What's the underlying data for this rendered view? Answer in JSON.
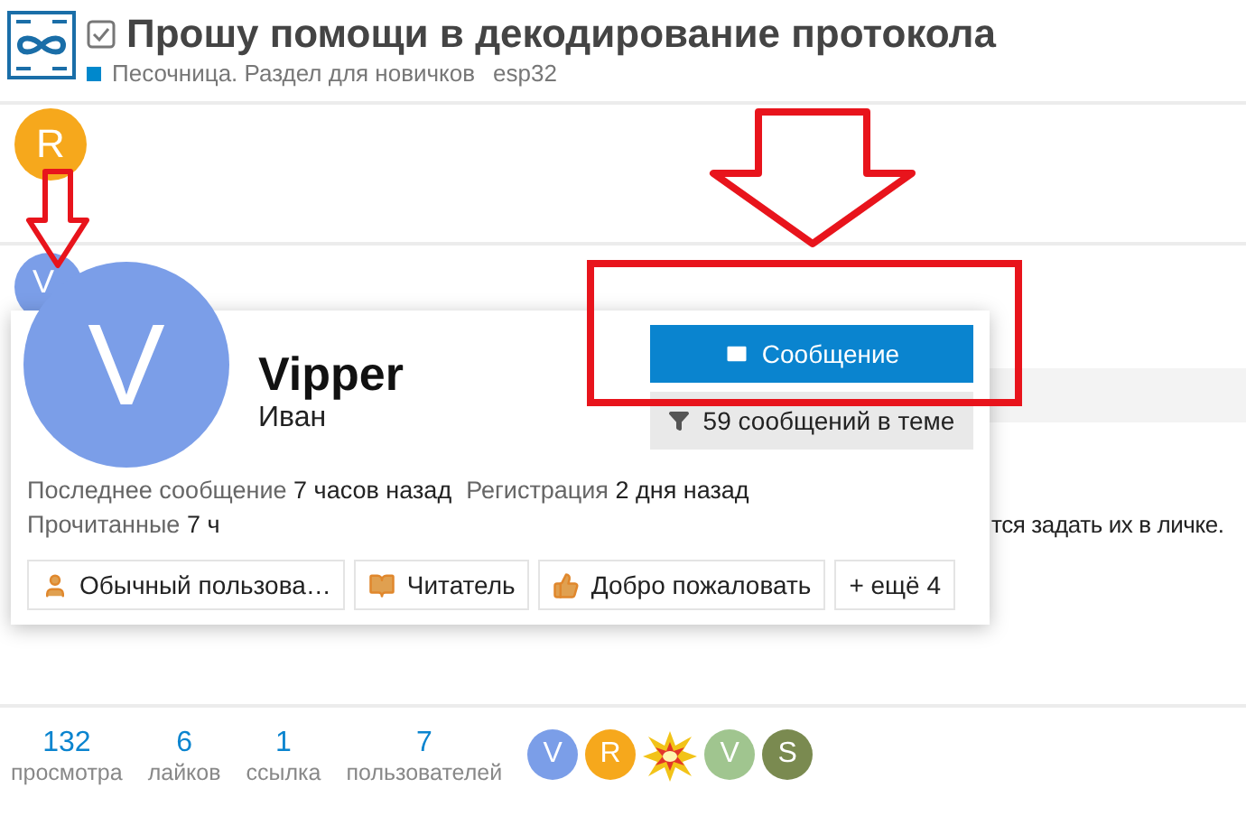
{
  "topic": {
    "title": "Прошу помощи в декодирование протокола",
    "solved": true,
    "category": {
      "name": "Песочница. Раздел для новичков",
      "color": "#0088cc"
    },
    "tag": "esp32"
  },
  "first_post": {
    "avatar": {
      "letter": "R",
      "color": "#f6a81c"
    }
  },
  "second_post": {
    "avatar": {
      "letter": "V",
      "color": "#7b9ee8"
    },
    "excerpt": "тся задать их в личке."
  },
  "user_card": {
    "avatar": {
      "letter": "V",
      "color": "#7b9ee8"
    },
    "username": "Vipper",
    "name": "Иван",
    "message_button": "Сообщение",
    "filter_button": "59 сообщений в теме",
    "stats": [
      {
        "label": "Последнее сообщение",
        "value": "7 часов назад"
      },
      {
        "label": "Регистрация",
        "value": "2 дня назад"
      },
      {
        "label": "Прочитанные",
        "value": "7 ч"
      }
    ],
    "badges": [
      {
        "kind": "person",
        "label": "Обычный пользова…"
      },
      {
        "kind": "reader",
        "label": "Читатель"
      },
      {
        "kind": "like",
        "label": "Добро пожаловать"
      },
      {
        "kind": "more",
        "label": "+ ещё 4"
      }
    ]
  },
  "topic_stats": [
    {
      "value": "132",
      "label": "просмотра"
    },
    {
      "value": "6",
      "label": "лайков"
    },
    {
      "value": "1",
      "label": "ссылка"
    },
    {
      "value": "7",
      "label": "пользователей"
    }
  ],
  "participants": [
    {
      "kind": "letter",
      "letter": "V",
      "color": "#7b9ee8"
    },
    {
      "kind": "letter",
      "letter": "R",
      "color": "#f6a81c"
    },
    {
      "kind": "picture"
    },
    {
      "kind": "letter",
      "letter": "V",
      "color": "#a0c58f"
    },
    {
      "kind": "letter",
      "letter": "S",
      "color": "#7a8a50"
    }
  ]
}
